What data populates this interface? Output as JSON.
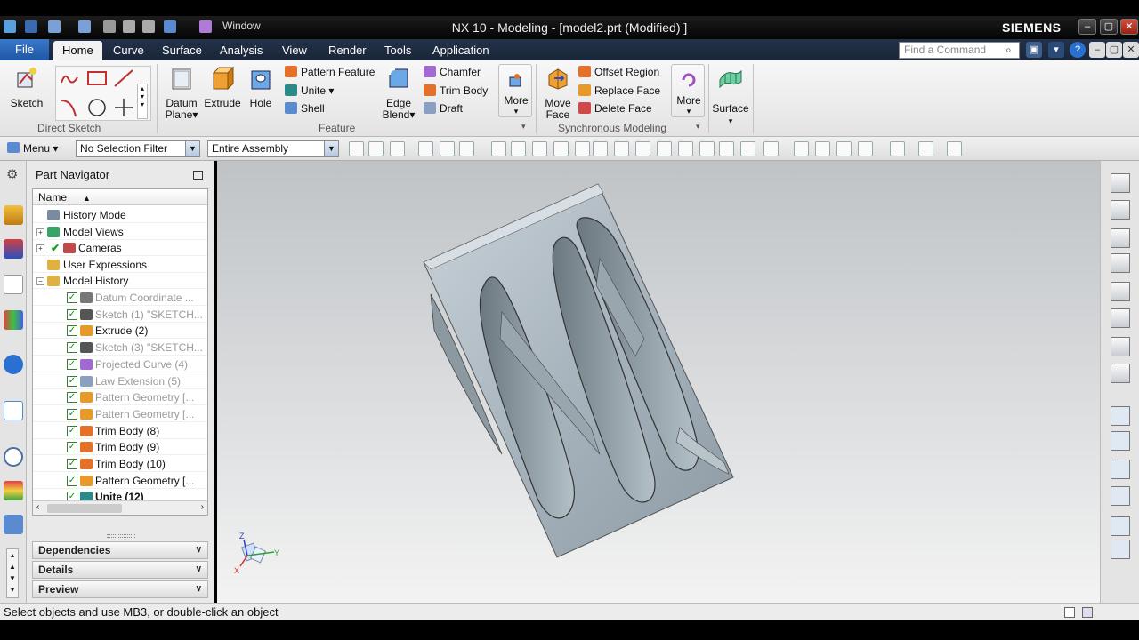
{
  "window": {
    "title": "NX 10 - Modeling - [model2.prt (Modified) ]",
    "brand": "SIEMENS",
    "quick_access_window": "Window"
  },
  "tabs": [
    "File",
    "Home",
    "Curve",
    "Surface",
    "Analysis",
    "View",
    "Render",
    "Tools",
    "Application"
  ],
  "find_command_placeholder": "Find a Command",
  "ribbon": {
    "direct_sketch": {
      "sketch": "Sketch",
      "group_label": "Direct Sketch"
    },
    "feature": {
      "datum_plane": [
        "Datum",
        "Plane"
      ],
      "extrude": "Extrude",
      "hole": "Hole",
      "pattern_feature": "Pattern Feature",
      "unite": "Unite",
      "shell": "Shell",
      "edge_blend": [
        "Edge",
        "Blend"
      ],
      "chamfer": "Chamfer",
      "trim_body": "Trim Body",
      "draft": "Draft",
      "more": "More",
      "group_label": "Feature"
    },
    "sync": {
      "move_face": [
        "Move",
        "Face"
      ],
      "offset_region": "Offset Region",
      "replace_face": "Replace Face",
      "delete_face": "Delete Face",
      "more": "More",
      "group_label": "Synchronous Modeling"
    },
    "surface": "Surface"
  },
  "selection_bar": {
    "menu": "Menu",
    "filter": "No Selection Filter",
    "scope": "Entire Assembly"
  },
  "navigator": {
    "title": "Part Navigator",
    "column": "Name",
    "rows": [
      {
        "label": "History Mode",
        "icon_color": "#7a8aa0"
      },
      {
        "label": "Model Views",
        "icon_color": "#3aa36a"
      },
      {
        "label": "Cameras",
        "icon_color": "#c04a4a"
      },
      {
        "label": "User Expressions",
        "icon_color": "#e0b040"
      },
      {
        "label": "Model History",
        "icon_color": "#e0b040"
      },
      {
        "label": "Datum Coordinate ...",
        "icon_color": "#777777"
      },
      {
        "label": "Sketch (1) \"SKETCH...",
        "icon_color": "#555555"
      },
      {
        "label": "Extrude (2)",
        "icon_color": "#e59a2a"
      },
      {
        "label": "Sketch (3) \"SKETCH...",
        "icon_color": "#555555"
      },
      {
        "label": "Projected Curve (4)",
        "icon_color": "#a06ad0"
      },
      {
        "label": "Law Extension (5)",
        "icon_color": "#8aa0c0"
      },
      {
        "label": "Pattern Geometry [...",
        "icon_color": "#e59a2a"
      },
      {
        "label": "Pattern Geometry [...",
        "icon_color": "#e59a2a"
      },
      {
        "label": "Trim Body (8)",
        "icon_color": "#e5702a"
      },
      {
        "label": "Trim Body (9)",
        "icon_color": "#e5702a"
      },
      {
        "label": "Trim Body (10)",
        "icon_color": "#e5702a"
      },
      {
        "label": "Pattern Geometry [...",
        "icon_color": "#e59a2a"
      },
      {
        "label": "Unite (12)",
        "icon_color": "#2a8a8a"
      }
    ],
    "panels": [
      "Dependencies",
      "Details",
      "Preview"
    ]
  },
  "triad": {
    "z": "Z",
    "y": "Y",
    "x": "X"
  },
  "status": "Select objects and use MB3, or double-click an object"
}
